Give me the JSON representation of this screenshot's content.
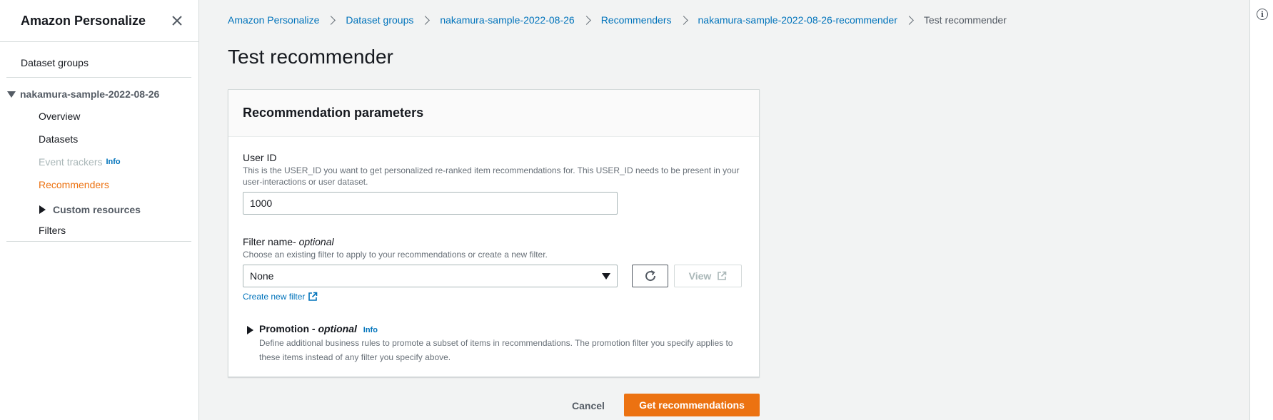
{
  "sidebar": {
    "title": "Amazon Personalize",
    "dataset_groups": "Dataset groups",
    "group_name": "nakamura-sample-2022-08-26",
    "items": {
      "overview": "Overview",
      "datasets": "Datasets",
      "event_trackers": "Event trackers",
      "event_trackers_info": "Info",
      "recommenders": "Recommenders",
      "custom_resources": "Custom resources",
      "filters": "Filters"
    }
  },
  "breadcrumb": {
    "items": [
      "Amazon Personalize",
      "Dataset groups",
      "nakamura-sample-2022-08-26",
      "Recommenders",
      "nakamura-sample-2022-08-26-recommender"
    ],
    "current": "Test recommender"
  },
  "page": {
    "title": "Test recommender"
  },
  "panel": {
    "title": "Recommendation parameters",
    "user_id": {
      "label": "User ID",
      "description": "This is the USER_ID you want to get personalized re-ranked item recommendations for. This USER_ID needs to be present in your user-interactions or user dataset.",
      "value": "1000"
    },
    "filter": {
      "label": "Filter name-",
      "optional": "optional",
      "description": "Choose an existing filter to apply to your recommendations or create a new filter.",
      "selected": "None",
      "view_label": "View",
      "create_link": "Create new filter"
    },
    "promotion": {
      "title": "Promotion -",
      "optional": "optional",
      "info": "Info",
      "description": "Define additional business rules to promote a subset of items in recommendations. The promotion filter you specify applies to these items instead of any filter you specify above."
    }
  },
  "actions": {
    "cancel": "Cancel",
    "primary": "Get recommendations"
  },
  "colors": {
    "accent": "#ec7211",
    "link": "#0073bb",
    "background": "#f2f3f3"
  }
}
